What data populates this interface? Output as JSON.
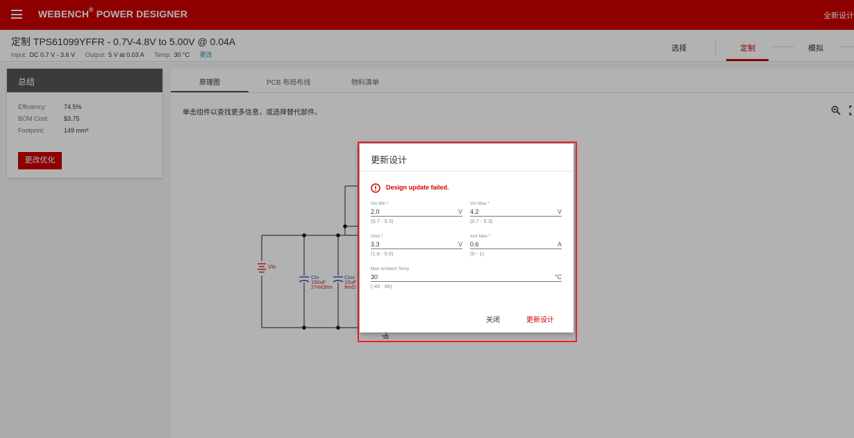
{
  "app": {
    "brand": "WEBENCH",
    "brand_mark": "®",
    "brand_suffix": " POWER DESIGNER",
    "top_right_link": "全新设计"
  },
  "design": {
    "title": "定制 TPS61099YFFR -  0.7V-4.8V to 5.00V @ 0.04A",
    "input_label": "Input:",
    "input_value": "DC 0.7 V - 3.6 V",
    "output_label": "Output:",
    "output_value": "5 V at 0.03 A",
    "temp_label": "Temp:",
    "temp_value": "30 °C",
    "change_link": "更改"
  },
  "steps": [
    {
      "label": "选择",
      "active": false
    },
    {
      "label": "定制",
      "active": true
    },
    {
      "label": "模拟",
      "active": false
    }
  ],
  "summary": {
    "title": "总结",
    "rows": [
      {
        "label": "Efficiency:",
        "value": "74.5%"
      },
      {
        "label": "BOM Cost:",
        "value": "$3.75"
      },
      {
        "label": "Footprint:",
        "value": "149 mm²"
      }
    ],
    "optimize_button": "更改优化"
  },
  "tabs": [
    {
      "label": "原理图",
      "active": true
    },
    {
      "label": "PCB 布局布线",
      "active": false
    },
    {
      "label": "物料清单",
      "active": false
    }
  ],
  "hint": "单击组件以查找更多信息，或选择替代部件。",
  "schematic": {
    "vin_label": "Vin",
    "cin_label": "Cin",
    "cin_value": "150uF",
    "cin_esr": "27mOhm",
    "cinx_label": "Cinx",
    "cinx_value": "10uF",
    "cinx_esr": "9mO"
  },
  "dialog": {
    "title": "更新设计",
    "error": "Design update failed.",
    "fields": {
      "vin_min": {
        "label": "Vin Min *",
        "value": "2.0",
        "unit": "V",
        "range": "(0.7 - 5.3)"
      },
      "vin_max": {
        "label": "Vin Max *",
        "value": "4.2",
        "unit": "V",
        "range": "(0.7 - 5.3)"
      },
      "vout": {
        "label": "Vout *",
        "value": "3.3",
        "unit": "V",
        "range": "(1.8 - 5.5)"
      },
      "iout_max": {
        "label": "Iout Max *",
        "value": "0.6",
        "unit": "A",
        "range": "(0 - 1)"
      },
      "max_ambient_temp": {
        "label": "Max Ambient Temp",
        "value": "30",
        "unit": "°C",
        "range": "(-40 - 85)"
      }
    },
    "close_button": "关闭",
    "update_button": "更新设计"
  },
  "colors": {
    "brand_red": "#cc0000",
    "summary_header": "#555555",
    "error_red": "#cc0000",
    "link_blue": "#2a8fbd",
    "schematic_red": "#cc2222",
    "schematic_blue": "#2255aa"
  },
  "icons": [
    "menu-icon",
    "alert-circle-icon",
    "zoom-in-icon",
    "fullscreen-icon",
    "battery-source-icon",
    "capacitor-icon",
    "ground-icon"
  ]
}
